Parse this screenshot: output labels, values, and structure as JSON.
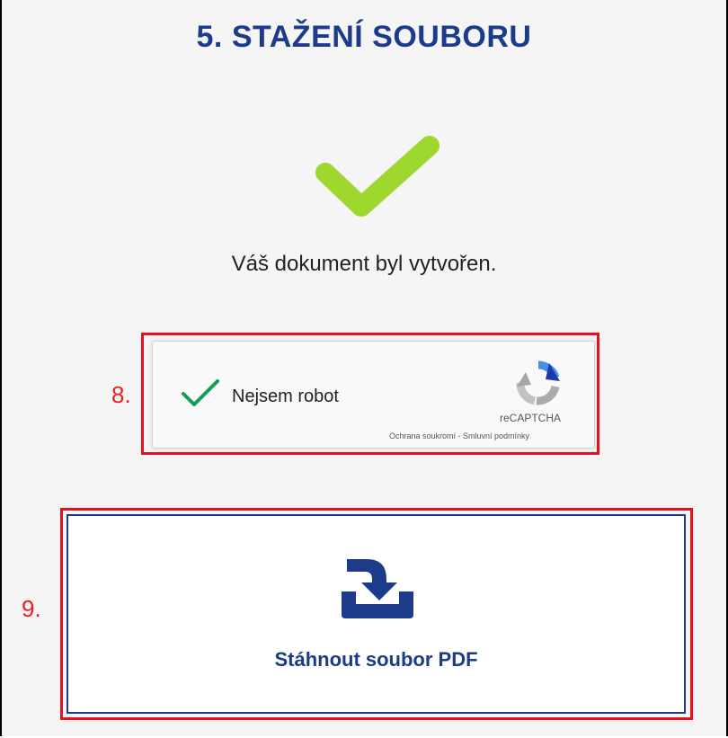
{
  "section": {
    "title": "5. STAŽENÍ SOUBORU",
    "status_message": "Váš dokument byl vytvořen.",
    "success_icon": "checkmark-icon"
  },
  "recaptcha": {
    "step_label": "8.",
    "label": "Nejsem robot",
    "checked": true,
    "brand": "reCAPTCHA",
    "links": "Ochrana soukromí - Smluvní podmínky",
    "logo_icon": "recaptcha-logo-icon"
  },
  "download": {
    "step_label": "9.",
    "label": "Stáhnout soubor PDF",
    "icon": "download-icon"
  },
  "colors": {
    "title": "#1d3b8b",
    "success_check": "#9ed82f",
    "captcha_check": "#0f9d58",
    "highlight": "#e8101e",
    "button_border": "#1d3b8b"
  }
}
